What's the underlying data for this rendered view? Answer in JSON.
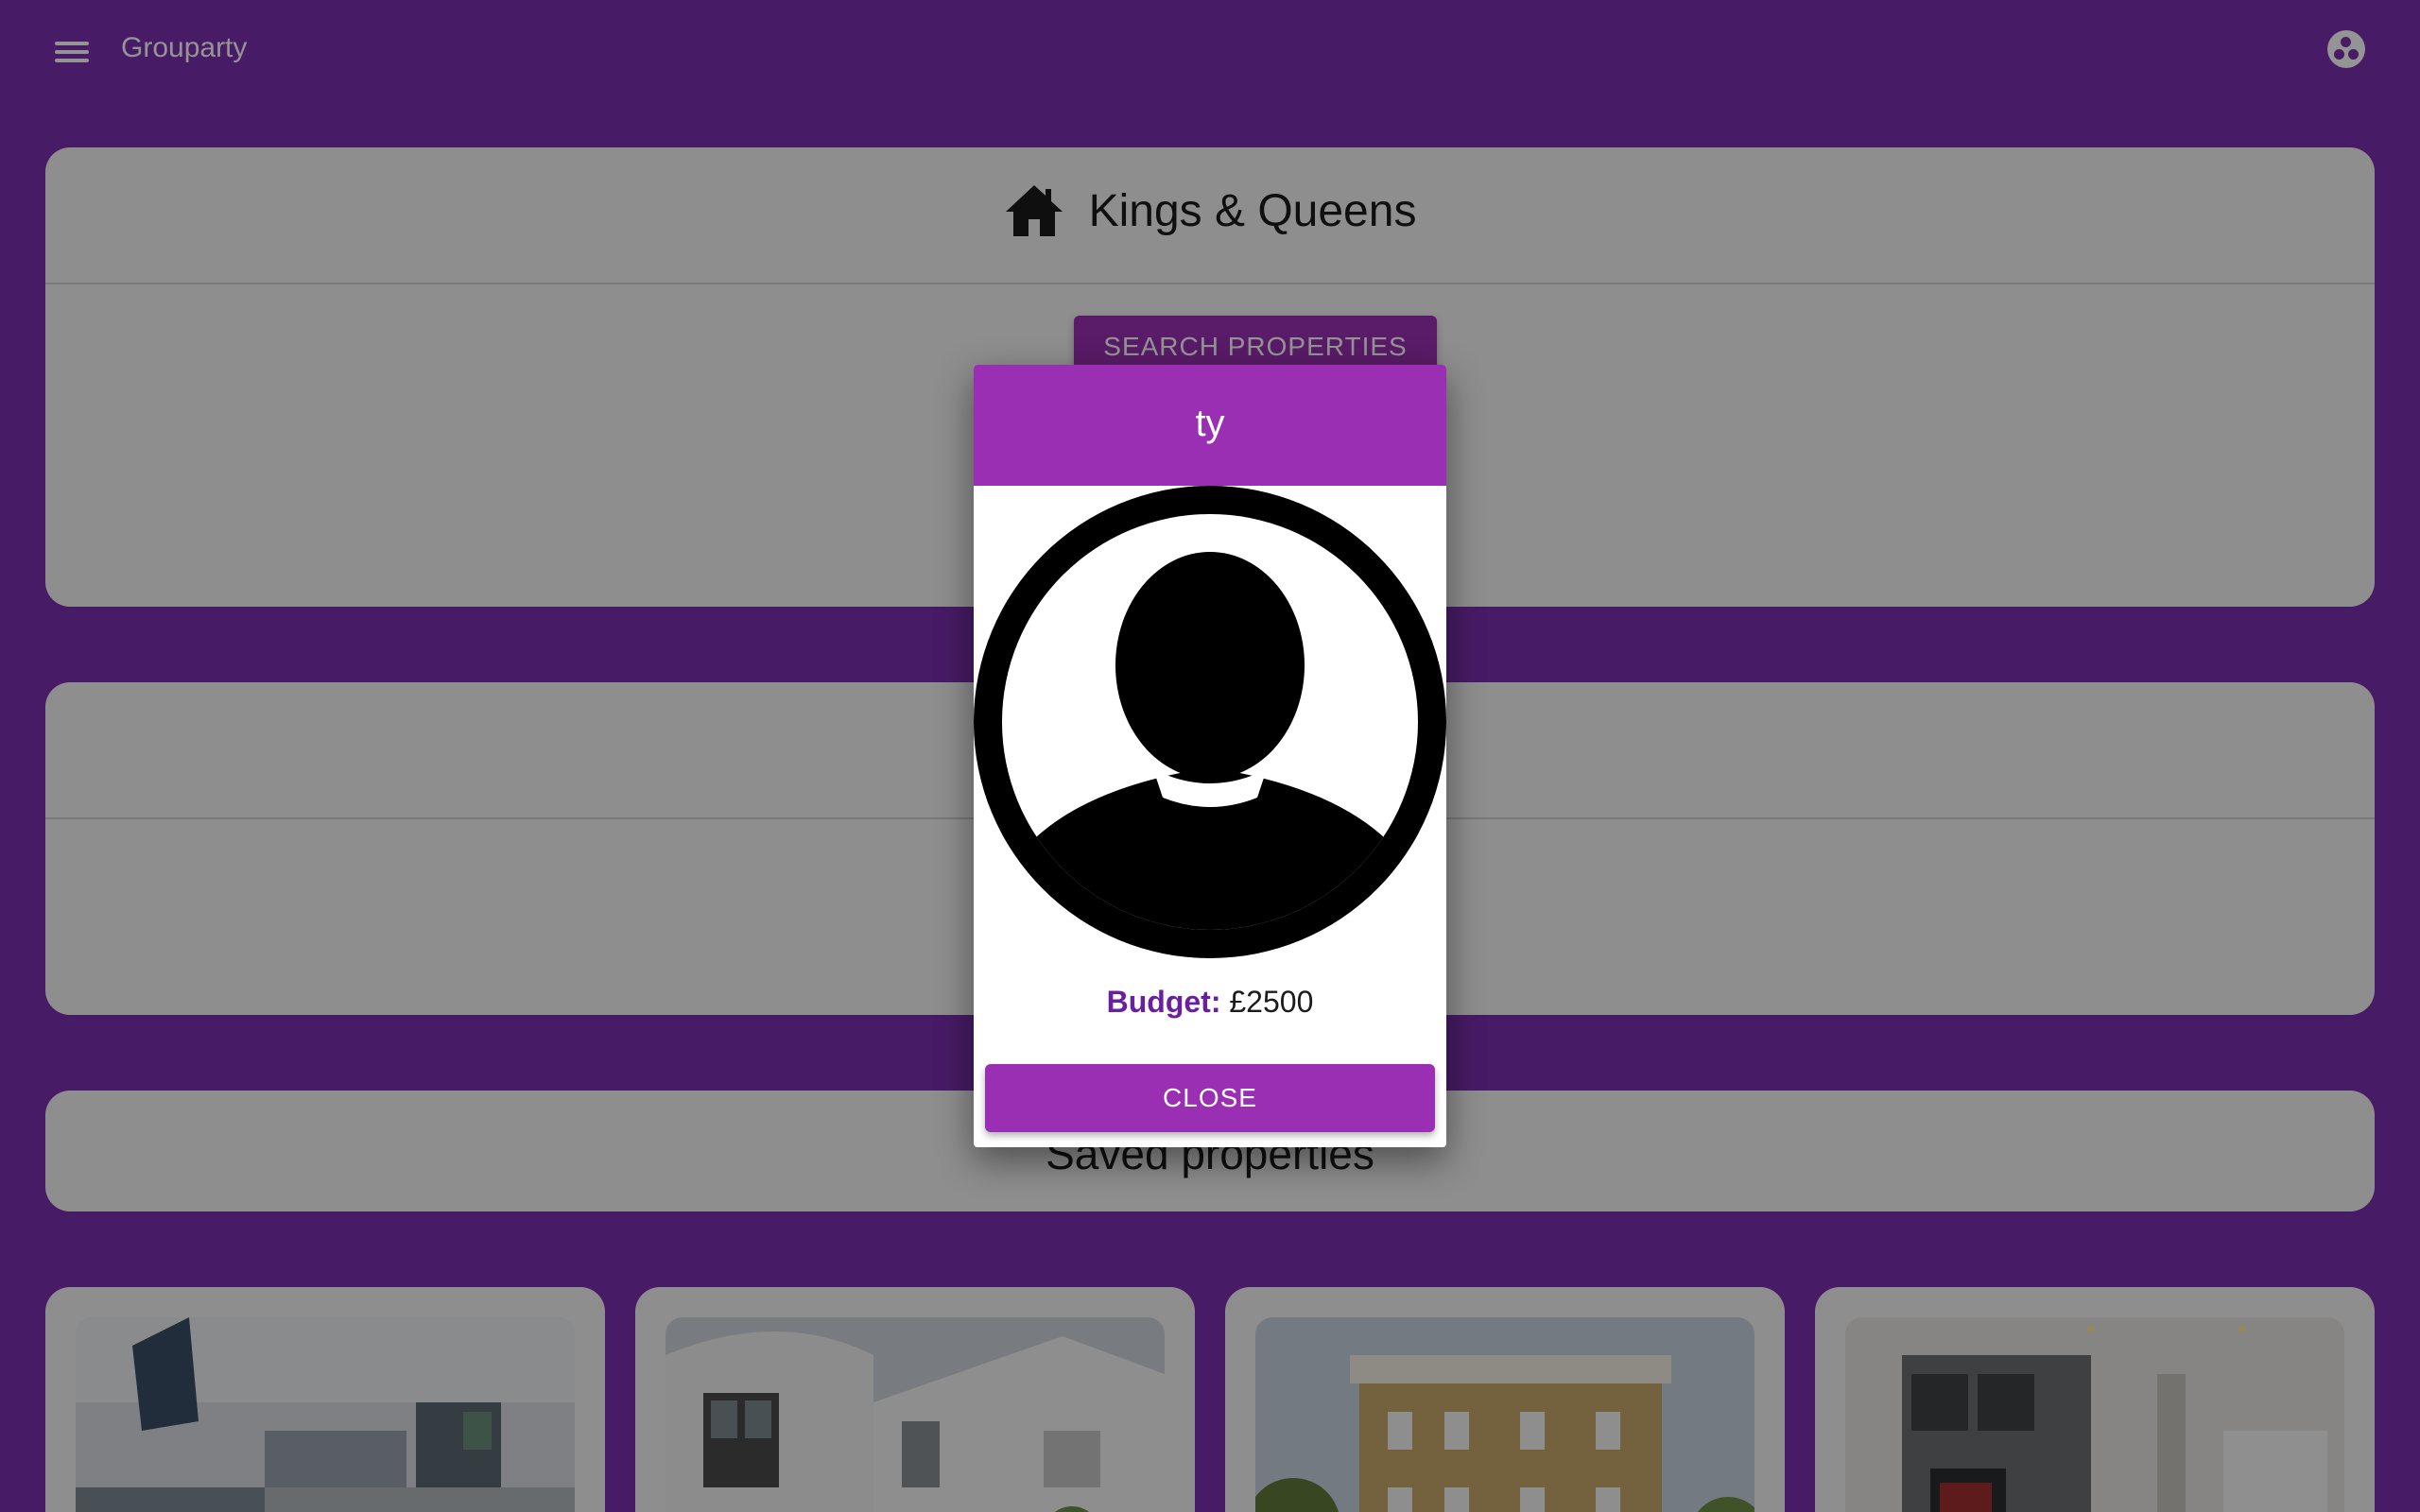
{
  "header": {
    "app_title": "Grouparty",
    "menu_icon": "menu-icon",
    "account_icon": "account-icon"
  },
  "group": {
    "icon": "home-icon",
    "title": "Kings & Queens",
    "search_label": "SEARCH PROPERTIES"
  },
  "saved": {
    "title": "Saved properties"
  },
  "properties": [
    {
      "image": "modern-interior-photo"
    },
    {
      "image": "white-house-exterior-photo"
    },
    {
      "image": "brick-townhouse-photo"
    },
    {
      "image": "living-room-interior-photo"
    }
  ],
  "modal": {
    "title": "ty",
    "avatar_icon": "user-avatar-icon",
    "budget_label": "Budget:",
    "budget_value": "£2500",
    "close_label": "CLOSE"
  },
  "colors": {
    "primary": "#9b2fb4",
    "background": "#7a2fae",
    "budget_label": "#6a1fa0"
  }
}
